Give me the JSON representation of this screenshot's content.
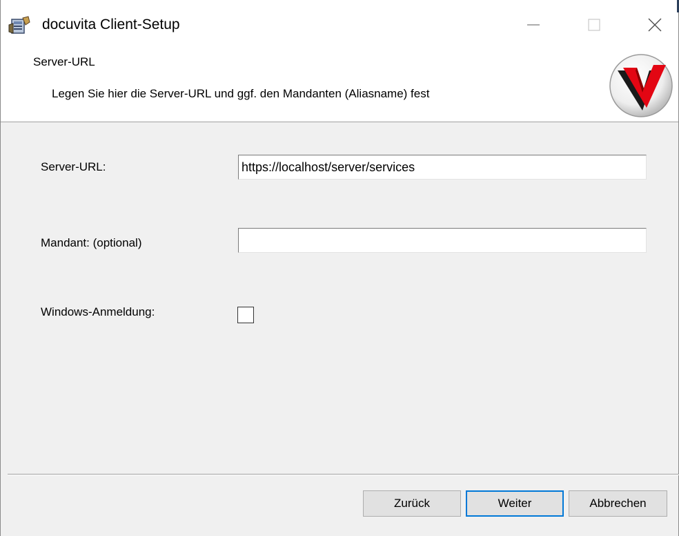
{
  "window": {
    "title": "docuvita Client-Setup"
  },
  "titlebar_buttons": {
    "minimize_icon": "minimize-icon",
    "maximize_icon": "maximize-icon",
    "close_icon": "close-icon"
  },
  "banner": {
    "title": "Server-URL",
    "description": "Legen Sie hier die Server-URL und ggf. den Mandanten (Aliasname) fest",
    "logo_icon": "docuvita-v-logo"
  },
  "form": {
    "server_url_label": "Server-URL:",
    "server_url_value": "https://localhost/server/services",
    "mandant_label": "Mandant: (optional)",
    "mandant_value": "",
    "windows_login_label": "Windows-Anmeldung:",
    "windows_login_checked": false
  },
  "buttons": {
    "back": "Zurück",
    "next": "Weiter",
    "cancel": "Abbrechen"
  },
  "colors": {
    "accent": "#0078d7",
    "logo_red": "#e30613",
    "logo_dark": "#1a1a1a"
  }
}
